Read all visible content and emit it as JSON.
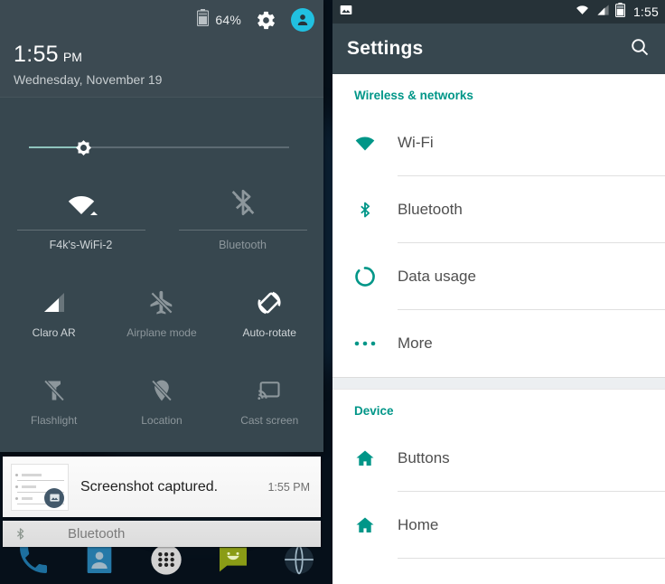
{
  "left_phone": {
    "quick_settings": {
      "battery_percent": "64%",
      "battery_icon": "battery-icon",
      "settings_icon": "gear-icon",
      "avatar_icon": "user-avatar-icon",
      "clock_time": "1:55",
      "clock_ampm": "PM",
      "date": "Wednesday, November 19",
      "brightness_icon": "brightness-sun-icon",
      "brightness_percent": 20,
      "big_tiles": [
        {
          "label": "F4k's-WiFi-2",
          "icon": "wifi-icon",
          "state": "on"
        },
        {
          "label": "Bluetooth",
          "icon": "bluetooth-off-icon",
          "state": "off"
        }
      ],
      "tiles": [
        {
          "label": "Claro AR",
          "icon": "cellular-signal-icon",
          "state": "on"
        },
        {
          "label": "Airplane mode",
          "icon": "airplane-off-icon",
          "state": "off"
        },
        {
          "label": "Auto-rotate",
          "icon": "auto-rotate-icon",
          "state": "on"
        },
        {
          "label": "Flashlight",
          "icon": "flashlight-off-icon",
          "state": "off"
        },
        {
          "label": "Location",
          "icon": "location-off-icon",
          "state": "off"
        },
        {
          "label": "Cast screen",
          "icon": "cast-screen-icon",
          "state": "off"
        }
      ]
    },
    "notifications": [
      {
        "title": "Screenshot captured.",
        "time": "1:55 PM",
        "icon": "screenshot-image-icon"
      },
      {
        "title": "Bluetooth",
        "icon": "bluetooth-icon"
      }
    ],
    "dock_icons": [
      "phone-icon",
      "contacts-icon",
      "app-drawer-icon",
      "messaging-icon",
      "browser-icon"
    ]
  },
  "right_phone": {
    "status_bar": {
      "notification_icon": "image-icon",
      "wifi_icon": "wifi-icon",
      "signal_icon": "cellular-signal-icon",
      "battery_icon": "battery-icon",
      "time": "1:55"
    },
    "app_bar": {
      "title": "Settings",
      "search_icon": "search-icon"
    },
    "sections": [
      {
        "header": "Wireless & networks",
        "items": [
          {
            "label": "Wi-Fi",
            "icon": "wifi-icon"
          },
          {
            "label": "Bluetooth",
            "icon": "bluetooth-icon"
          },
          {
            "label": "Data usage",
            "icon": "data-usage-icon"
          },
          {
            "label": "More",
            "icon": "more-dots-icon"
          }
        ]
      },
      {
        "header": "Device",
        "items": [
          {
            "label": "Buttons",
            "icon": "home-icon"
          },
          {
            "label": "Home",
            "icon": "home-icon"
          }
        ]
      }
    ]
  },
  "colors": {
    "accent_teal": "#009688",
    "panel_dark": "#37474f",
    "avatar_cyan": "#21c0e0",
    "brightness_fill": "#8fc4bd"
  }
}
